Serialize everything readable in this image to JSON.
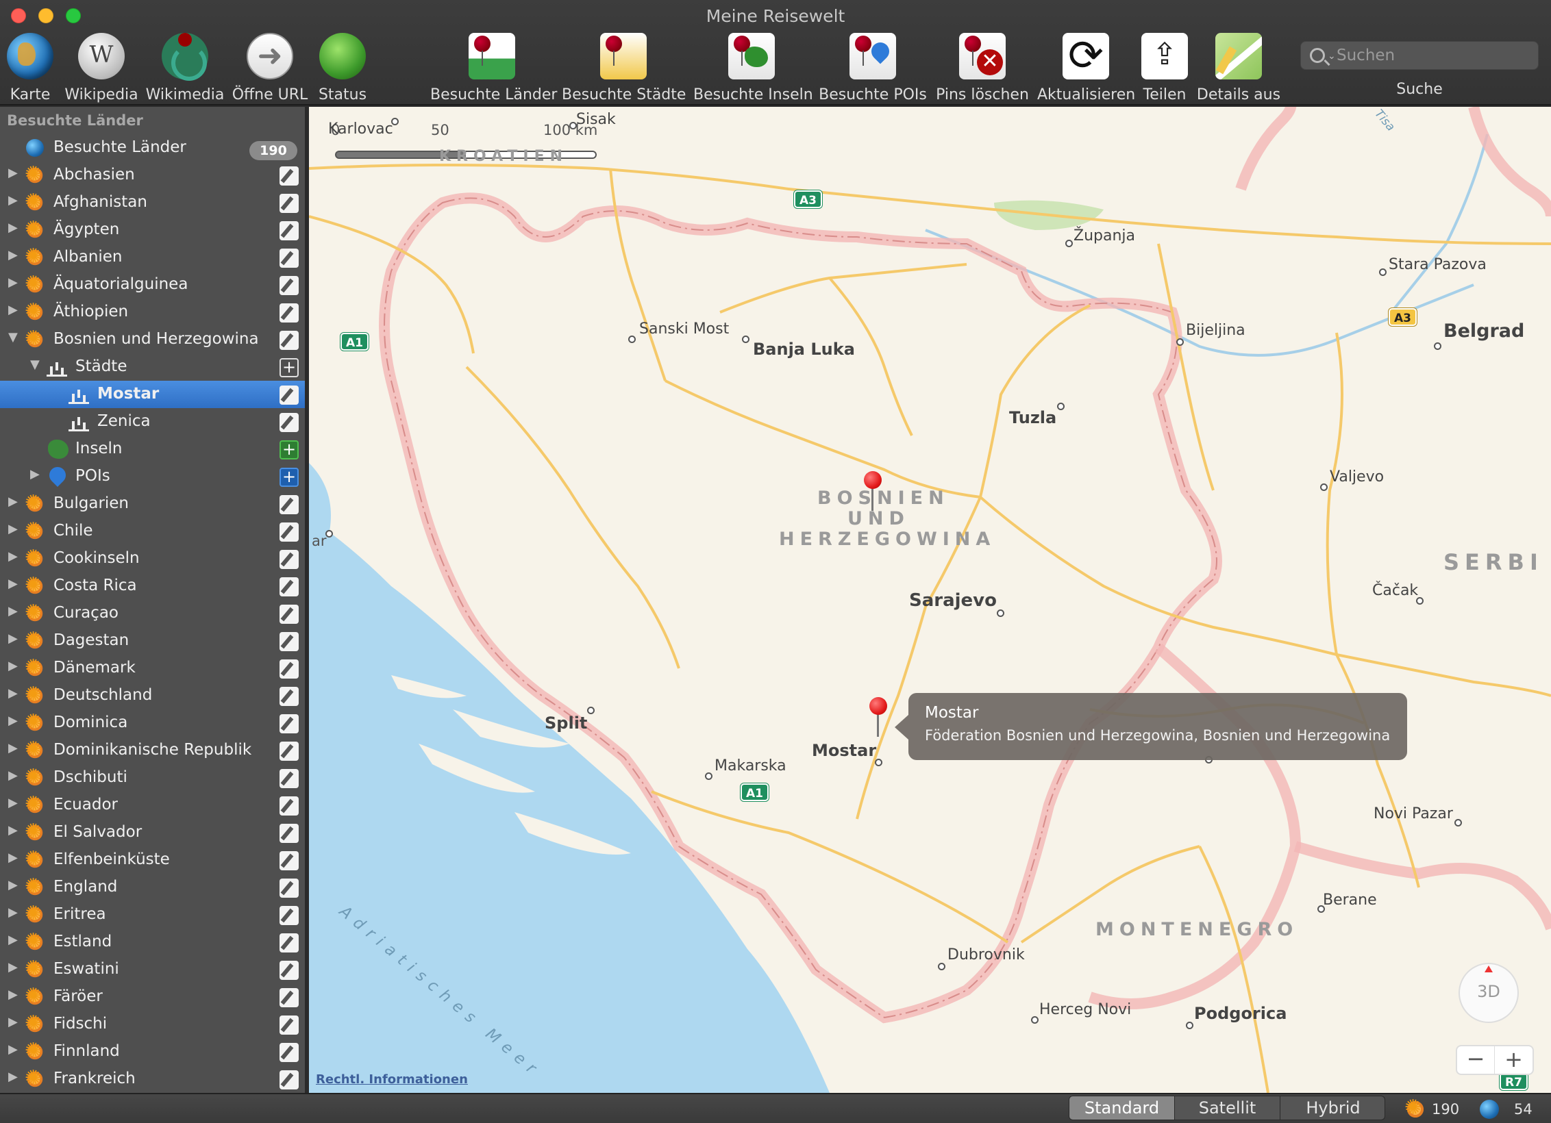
{
  "window": {
    "title": "Meine Reisewelt"
  },
  "toolbar": {
    "items": [
      {
        "label": "Karte",
        "icon": "globe-icon"
      },
      {
        "label": "Wikipedia",
        "icon": "wikipedia-icon"
      },
      {
        "label": "Wikimedia",
        "icon": "wikimedia-icon"
      },
      {
        "label": "Öffne URL",
        "icon": "arrow-right-icon"
      },
      {
        "label": "Status",
        "icon": "status-globe-icon"
      },
      {
        "label": "Besuchte Länder",
        "icon": "pin-land-icon"
      },
      {
        "label": "Besuchte Städte",
        "icon": "pin-city-icon"
      },
      {
        "label": "Besuchte Inseln",
        "icon": "pin-island-icon"
      },
      {
        "label": "Besuchte POIs",
        "icon": "pin-poi-icon"
      },
      {
        "label": "Pins löschen",
        "icon": "pin-delete-icon"
      },
      {
        "label": "Aktualisieren",
        "icon": "refresh-icon"
      },
      {
        "label": "Teilen",
        "icon": "share-icon"
      },
      {
        "label": "Details aus",
        "icon": "map-details-icon"
      }
    ],
    "search": {
      "placeholder": "Suchen",
      "label": "Suche"
    }
  },
  "sidebar": {
    "heading": "Besuchte Länder",
    "root": {
      "label": "Besuchte Länder",
      "count": "190"
    },
    "countries_top": [
      "Abchasien",
      "Afghanistan",
      "Ägypten",
      "Albanien",
      "Äquatorialguinea",
      "Äthiopien",
      "Bosnien und Herzegowina"
    ],
    "expanded": {
      "staedte_label": "Städte",
      "cities": [
        "Mostar",
        "Zenica"
      ],
      "selected_city": "Mostar",
      "inseln_label": "Inseln",
      "pois_label": "POIs"
    },
    "countries_bottom": [
      "Bulgarien",
      "Chile",
      "Cookinseln",
      "Costa Rica",
      "Curaçao",
      "Dagestan",
      "Dänemark",
      "Deutschland",
      "Dominica",
      "Dominikanische Republik",
      "Dschibuti",
      "Ecuador",
      "El Salvador",
      "Elfenbeinküste",
      "England",
      "Eritrea",
      "Estland",
      "Eswatini",
      "Färöer",
      "Fidschi",
      "Finnland",
      "Frankreich"
    ]
  },
  "map": {
    "scale": {
      "zero": "0",
      "mid": "50",
      "end": "100 km"
    },
    "labels": {
      "karlovac": "Karlovac",
      "sisak": "Sisak",
      "kroatien": "KROATIEN",
      "zupanja": "Županja",
      "stara_pazova": "Stara Pazova",
      "belgrad": "Belgrad",
      "sanski_most": "Sanski Most",
      "banja_luka": "Banja Luka",
      "bijeljina": "Bijeljina",
      "tuzla": "Tuzla",
      "valjevo": "Valjevo",
      "bih1": "BOSNIEN",
      "bih2": "UND",
      "bih3": "HERZEGOWINA",
      "serbien": "SERBI",
      "sarajevo": "Sarajevo",
      "cacak": "Čačak",
      "split": "Split",
      "makarska": "Makarska",
      "mostar": "Mostar",
      "novi_pazar": "Novi Pazar",
      "berane": "Berane",
      "montenegro": "MONTENEGRO",
      "dubrovnik": "Dubrovnik",
      "herceg_novi": "Herceg Novi",
      "podgorica": "Podgorica",
      "adria": "Adriatisches Meer",
      "tisa": "Tisa",
      "zar": "ar"
    },
    "shields": {
      "a3_top": "A3",
      "a3_right": "A3",
      "a1_left": "A1",
      "a1_bottom": "A1",
      "r7": "R7"
    },
    "callout": {
      "title": "Mostar",
      "subtitle": "Föderation Bosnien und Herzegowina, Bosnien und Herzegowina"
    },
    "legal": "Rechtl. Informationen",
    "compass_label": "3D",
    "zoom_out": "−",
    "zoom_in": "+"
  },
  "bottombar": {
    "modes": [
      "Standard",
      "Satellit",
      "Hybrid"
    ],
    "active_mode": "Standard",
    "countries_count": "190",
    "world_count": "54"
  },
  "colors": {
    "selection": "#2f6fc5",
    "border_pink": "#f2b7b5",
    "water": "#aed8f0",
    "road": "#f5c96a"
  }
}
